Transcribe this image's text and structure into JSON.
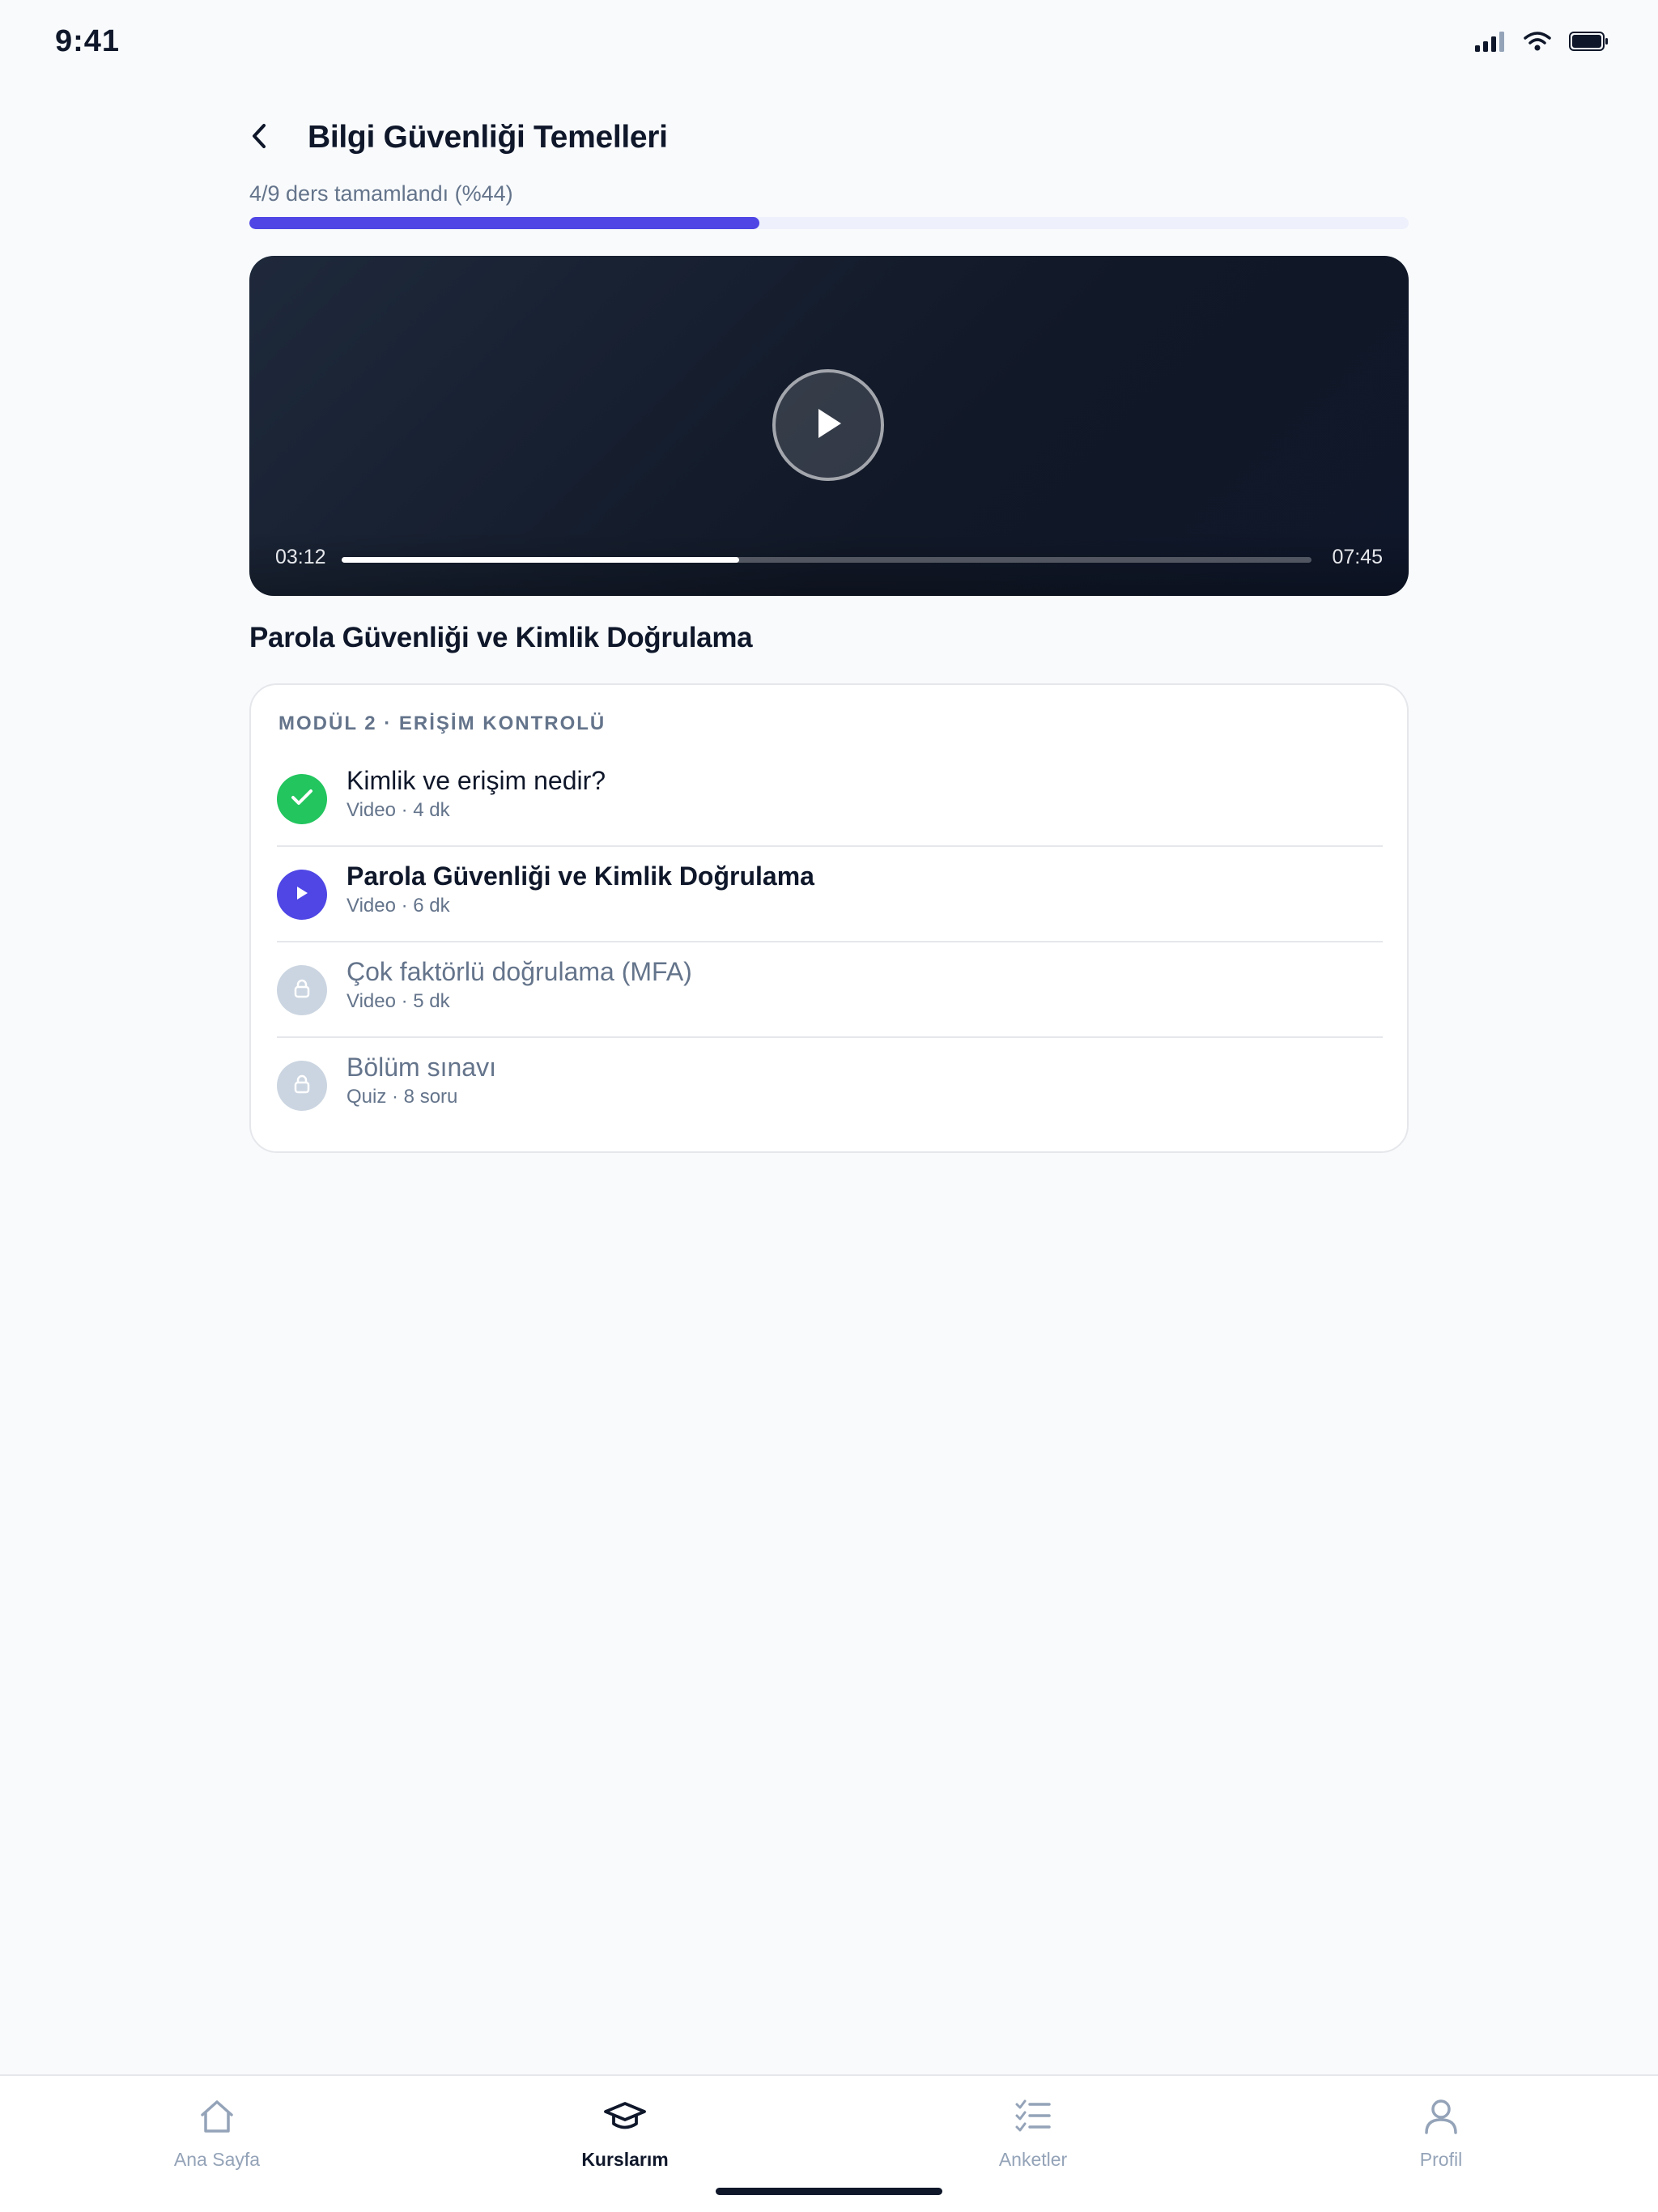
{
  "status_bar": {
    "time": "9:41"
  },
  "header": {
    "title": "Bilgi Güvenliği Temelleri"
  },
  "progress": {
    "label": "4/9 ders tamamlandı (%44)",
    "fraction": 0.44
  },
  "video": {
    "current_time": "03:12",
    "total_time": "07:45",
    "played_fraction": 0.41
  },
  "current_lesson_title": "Parola Güvenliği ve Kimlik Doğrulama",
  "module": {
    "label": "MODÜL 2 · ERİŞİM KONTROLÜ",
    "lessons": [
      {
        "title": "Kimlik ve erişim nedir?",
        "meta": "Video · 4 dk",
        "state": "completed",
        "icon": "check-icon"
      },
      {
        "title": "Parola Güvenliği ve Kimlik Doğrulama",
        "meta": "Video · 6 dk",
        "state": "active",
        "icon": "play-icon"
      },
      {
        "title": "Çok faktörlü doğrulama (MFA)",
        "meta": "Video · 5 dk",
        "state": "locked",
        "icon": "lock-icon"
      },
      {
        "title": "Bölüm sınavı",
        "meta": "Quiz · 8 soru",
        "state": "locked",
        "icon": "lock-icon"
      }
    ]
  },
  "tabs": [
    {
      "label": "Ana Sayfa",
      "icon": "home-icon",
      "active": false
    },
    {
      "label": "Kurslarım",
      "icon": "graduation-cap-icon",
      "active": true
    },
    {
      "label": "Anketler",
      "icon": "checklist-icon",
      "active": false
    },
    {
      "label": "Profil",
      "icon": "user-icon",
      "active": false
    }
  ],
  "colors": {
    "accent": "#4f46e5",
    "success": "#22c55e",
    "locked": "#cbd5e1",
    "background": "#f8fafc"
  }
}
